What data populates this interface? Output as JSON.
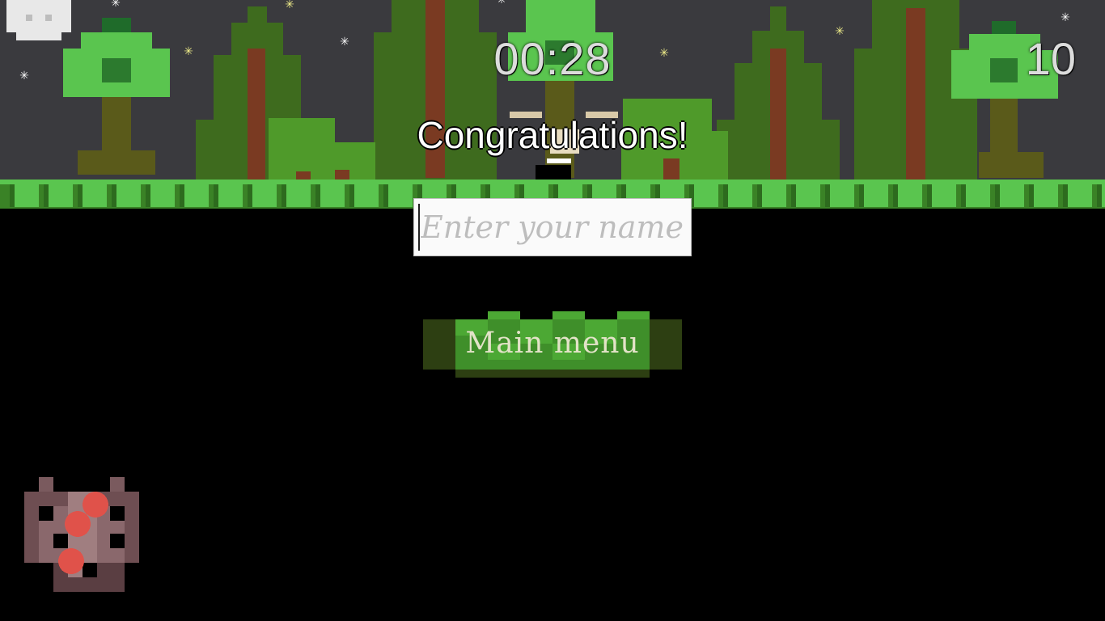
{
  "hud": {
    "timer": "00:28",
    "score": "10"
  },
  "dialog": {
    "title": "Congratulations!",
    "name_placeholder": "Enter your name",
    "main_menu_label": "Main menu"
  },
  "inventory": {
    "item_name": "berry-bag-icon",
    "berries_visible": 3
  },
  "colors": {
    "sky": "#3a3a3e",
    "grass": "#4ca834",
    "grass_dark": "#3a8226",
    "button_light": "#4ca834",
    "button_mid": "#3f8f2a",
    "button_dark": "#2d3f12",
    "leaf_light": "#5ac54f",
    "leaf_dark": "#2c7a2e",
    "trunk": "#5a5a1a"
  }
}
